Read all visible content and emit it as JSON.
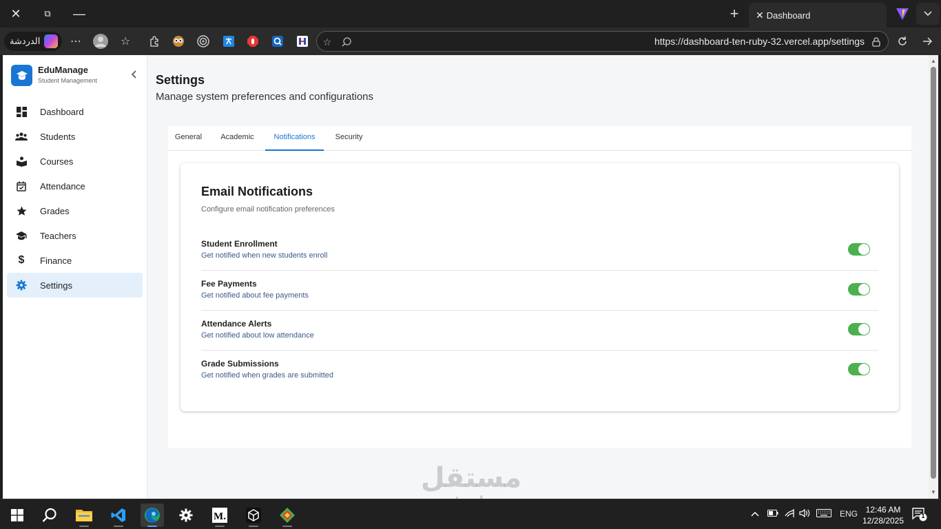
{
  "browser": {
    "tab_title": "Dashboard",
    "copilot_label": "الدردشة",
    "url": "https://dashboard-ten-ruby-32.vercel.app/settings"
  },
  "sidebar": {
    "brand_name": "EduManage",
    "brand_sub": "Student Management",
    "items": [
      {
        "label": "Dashboard",
        "icon": "dashboard-icon"
      },
      {
        "label": "Students",
        "icon": "people-icon"
      },
      {
        "label": "Courses",
        "icon": "book-icon"
      },
      {
        "label": "Attendance",
        "icon": "calendar-check-icon"
      },
      {
        "label": "Grades",
        "icon": "star-icon"
      },
      {
        "label": "Teachers",
        "icon": "school-icon"
      },
      {
        "label": "Finance",
        "icon": "dollar-icon"
      },
      {
        "label": "Settings",
        "icon": "gear-icon",
        "active": true
      }
    ]
  },
  "main": {
    "title": "Settings",
    "subtitle": "Manage system preferences and configurations",
    "tabs": [
      {
        "label": "General"
      },
      {
        "label": "Academic"
      },
      {
        "label": "Notifications",
        "active": true
      },
      {
        "label": "Security"
      }
    ],
    "card": {
      "title": "Email Notifications",
      "subtitle": "Configure email notification preferences",
      "rows": [
        {
          "title": "Student Enrollment",
          "desc": "Get notified when new students enroll",
          "enabled": true
        },
        {
          "title": "Fee Payments",
          "desc": "Get notified about fee payments",
          "enabled": true
        },
        {
          "title": "Attendance Alerts",
          "desc": "Get notified about low attendance",
          "enabled": true
        },
        {
          "title": "Grade Submissions",
          "desc": "Get notified when grades are submitted",
          "enabled": true
        }
      ]
    }
  },
  "taskbar": {
    "lang": "ENG",
    "time": "12:46 AM",
    "date": "12/28/2025",
    "notif_count": "1"
  },
  "watermark": {
    "arabic": "مستقل",
    "latin": "mostaql.com"
  },
  "colors": {
    "accent": "#1976d2",
    "toggle_on": "#4caf50",
    "active_nav_bg": "#e3f0fb"
  }
}
